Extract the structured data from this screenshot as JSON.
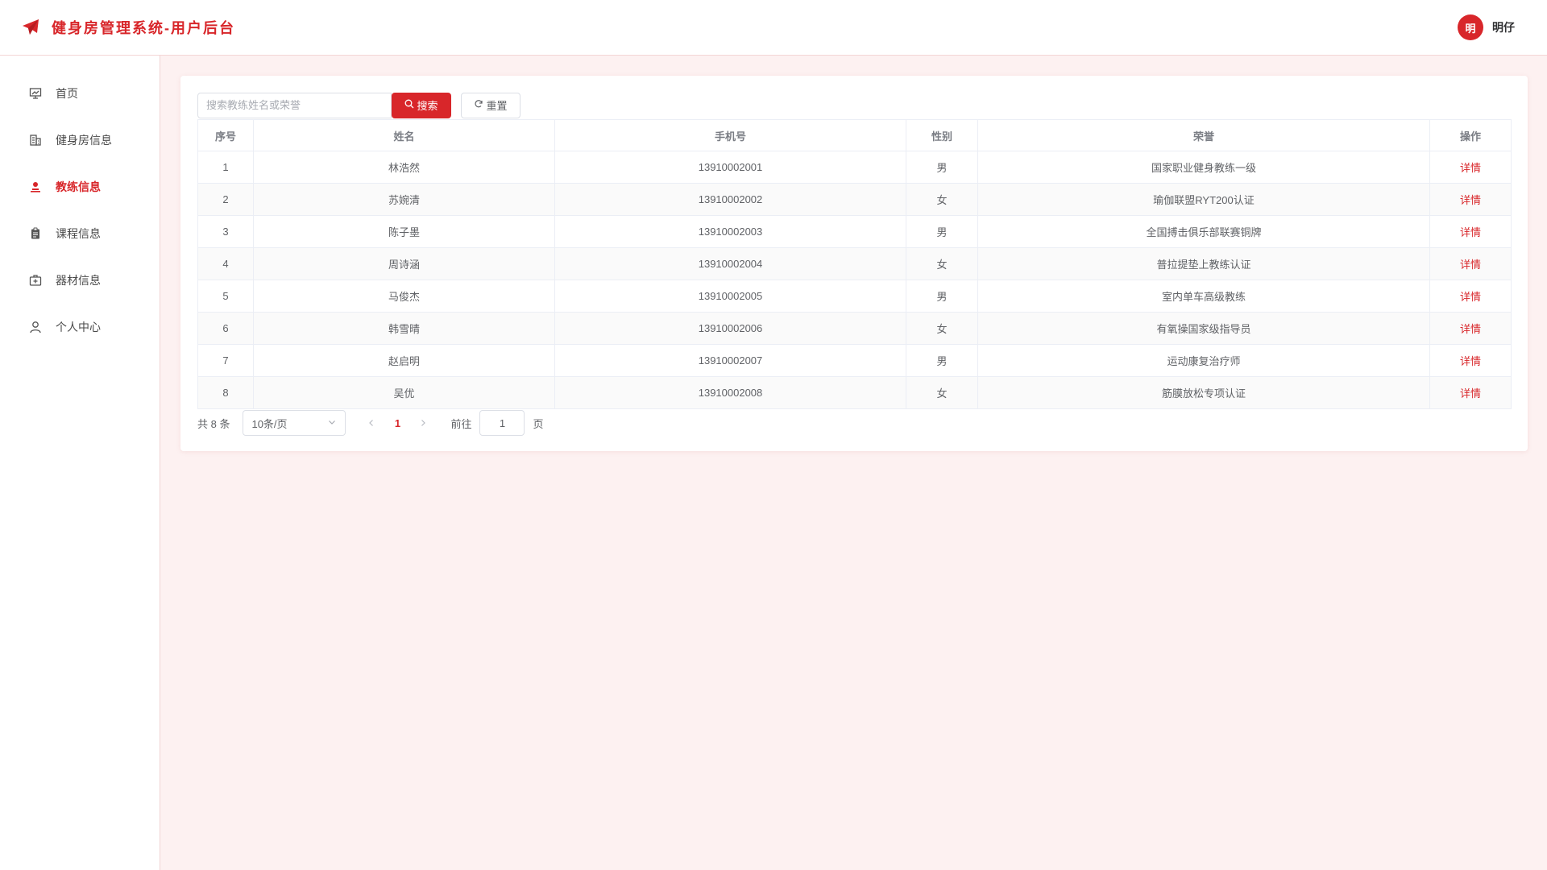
{
  "header": {
    "title": "健身房管理系统-用户后台",
    "brand_icon": "paper-plane-icon",
    "user": {
      "avatar_text": "明",
      "name": "明仔"
    }
  },
  "colors": {
    "accent": "#d8262a",
    "background": "#fdf1f1"
  },
  "sidebar": {
    "items": [
      {
        "label": "首页",
        "icon": "presentation-board-icon",
        "active": false
      },
      {
        "label": "健身房信息",
        "icon": "building-icon",
        "active": false
      },
      {
        "label": "教练信息",
        "icon": "user-stamp-icon",
        "active": true
      },
      {
        "label": "课程信息",
        "icon": "clipboard-icon",
        "active": false
      },
      {
        "label": "器材信息",
        "icon": "first-aid-box-icon",
        "active": false
      },
      {
        "label": "个人中心",
        "icon": "person-icon",
        "active": false
      }
    ]
  },
  "toolbar": {
    "search_placeholder": "搜索教练姓名或荣誉",
    "search_label": "搜索",
    "reset_label": "重置"
  },
  "table": {
    "headers": [
      "序号",
      "姓名",
      "手机号",
      "性别",
      "荣誉",
      "操作"
    ],
    "rows": [
      {
        "index": "1",
        "name": "林浩然",
        "phone": "13910002001",
        "gender": "男",
        "honor": "国家职业健身教练一级",
        "action": "详情"
      },
      {
        "index": "2",
        "name": "苏婉清",
        "phone": "13910002002",
        "gender": "女",
        "honor": "瑜伽联盟RYT200认证",
        "action": "详情"
      },
      {
        "index": "3",
        "name": "陈子墨",
        "phone": "13910002003",
        "gender": "男",
        "honor": "全国搏击俱乐部联赛铜牌",
        "action": "详情"
      },
      {
        "index": "4",
        "name": "周诗涵",
        "phone": "13910002004",
        "gender": "女",
        "honor": "普拉提垫上教练认证",
        "action": "详情"
      },
      {
        "index": "5",
        "name": "马俊杰",
        "phone": "13910002005",
        "gender": "男",
        "honor": "室内单车高级教练",
        "action": "详情"
      },
      {
        "index": "6",
        "name": "韩雪晴",
        "phone": "13910002006",
        "gender": "女",
        "honor": "有氧操国家级指导员",
        "action": "详情"
      },
      {
        "index": "7",
        "name": "赵启明",
        "phone": "13910002007",
        "gender": "男",
        "honor": "运动康复治疗师",
        "action": "详情"
      },
      {
        "index": "8",
        "name": "吴优",
        "phone": "13910002008",
        "gender": "女",
        "honor": "筋膜放松专项认证",
        "action": "详情"
      }
    ]
  },
  "pagination": {
    "total_text": "共 8 条",
    "page_size": "10条/页",
    "current_page": "1",
    "goto_label": "前往",
    "goto_value": "1",
    "page_suffix": "页"
  }
}
